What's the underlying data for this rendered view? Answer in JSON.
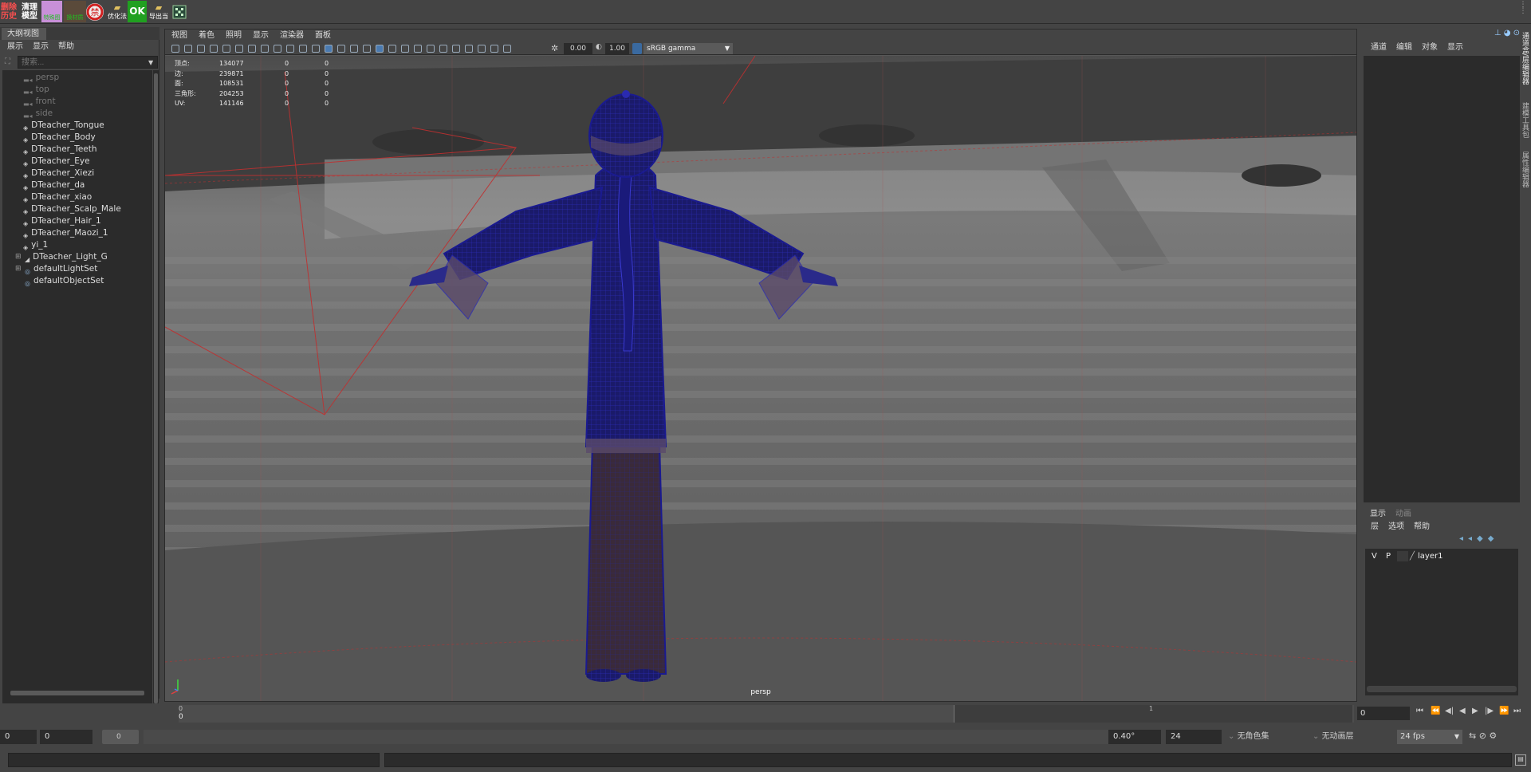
{
  "shelf": {
    "buttons": [
      {
        "label": "删除\n历史",
        "bg": "#1a1a1a",
        "color": "#ff5050"
      },
      {
        "label": "清理\n模型",
        "bg": "#1a1a1a",
        "color": "#ffffff"
      },
      {
        "label": "特殊图",
        "bg": "#d080d0",
        "color": "#20c020"
      },
      {
        "label": "换材质",
        "bg": "#6a4a3a",
        "color": "#20c020"
      },
      {
        "label": "禁",
        "bg": "#f0f0f0",
        "color": "#d02020"
      },
      {
        "label": "优化法",
        "bg": "#444444",
        "color": "#ffffff"
      },
      {
        "label": "OK",
        "bg": "#20a020",
        "color": "#ffffff"
      },
      {
        "label": "导出当",
        "bg": "#444444",
        "color": "#ffffff"
      },
      {
        "label": "",
        "bg": "#3a6a4a",
        "color": "#ffffff"
      }
    ]
  },
  "outliner": {
    "tab_label": "大纲视图",
    "menu": [
      "展示",
      "显示",
      "帮助"
    ],
    "search_placeholder": "搜索...",
    "items": [
      {
        "label": "persp",
        "type": "camera",
        "dim": true
      },
      {
        "label": "top",
        "type": "camera",
        "dim": true
      },
      {
        "label": "front",
        "type": "camera",
        "dim": true
      },
      {
        "label": "side",
        "type": "camera",
        "dim": true
      },
      {
        "label": "DTeacher_Tongue",
        "type": "mesh",
        "dim": false
      },
      {
        "label": "DTeacher_Body",
        "type": "mesh",
        "dim": false
      },
      {
        "label": "DTeacher_Teeth",
        "type": "mesh",
        "dim": false
      },
      {
        "label": "DTeacher_Eye",
        "type": "mesh",
        "dim": false
      },
      {
        "label": "DTeacher_Xiezi",
        "type": "mesh",
        "dim": false
      },
      {
        "label": "DTeacher_da",
        "type": "mesh",
        "dim": false
      },
      {
        "label": "DTeacher_xiao",
        "type": "mesh",
        "dim": false
      },
      {
        "label": "DTeacher_Scalp_Male",
        "type": "mesh",
        "dim": false
      },
      {
        "label": "DTeacher_Hair_1",
        "type": "mesh",
        "dim": false
      },
      {
        "label": "DTeacher_Maozi_1",
        "type": "mesh",
        "dim": false
      },
      {
        "label": "yi_1",
        "type": "mesh",
        "dim": false
      },
      {
        "label": "DTeacher_Light_G",
        "type": "light",
        "dim": false
      },
      {
        "label": "defaultLightSet",
        "type": "set",
        "dim": false
      },
      {
        "label": "defaultObjectSet",
        "type": "set",
        "dim": false
      }
    ]
  },
  "viewport": {
    "menu": [
      "视图",
      "着色",
      "照明",
      "显示",
      "渲染器",
      "面板"
    ],
    "exposure": "0.00",
    "gamma": "1.00",
    "color_space": "sRGB gamma",
    "camera_label": "persp",
    "stats": [
      {
        "label": "顶点:",
        "v1": "134077",
        "v2": "0",
        "v3": "0"
      },
      {
        "label": "边:",
        "v1": "239871",
        "v2": "0",
        "v3": "0"
      },
      {
        "label": "面:",
        "v1": "108531",
        "v2": "0",
        "v3": "0"
      },
      {
        "label": "三角形:",
        "v1": "204253",
        "v2": "0",
        "v3": "0"
      },
      {
        "label": "UV:",
        "v1": "141146",
        "v2": "0",
        "v3": "0"
      }
    ]
  },
  "channelbox": {
    "menu": [
      "通道",
      "编辑",
      "对象",
      "显示"
    ]
  },
  "layers": {
    "tabs": [
      "显示",
      "动画"
    ],
    "menu": [
      "层",
      "选项",
      "帮助"
    ],
    "row": {
      "v": "V",
      "p": "P",
      "name": "layer1"
    }
  },
  "side_tabs": [
    "通道盒/层编辑器",
    "建模工具包",
    "属性编辑器"
  ],
  "timeline": {
    "start_tick": "0",
    "current_tick": "0",
    "mid_tick": "1",
    "current_frame": "0"
  },
  "range": {
    "start": "0",
    "inner_start": "0",
    "slider_value": "0",
    "angle": "0.40°",
    "end": "24",
    "char_set": "无角色集",
    "anim_layer": "无动画层",
    "fps": "24 fps"
  }
}
